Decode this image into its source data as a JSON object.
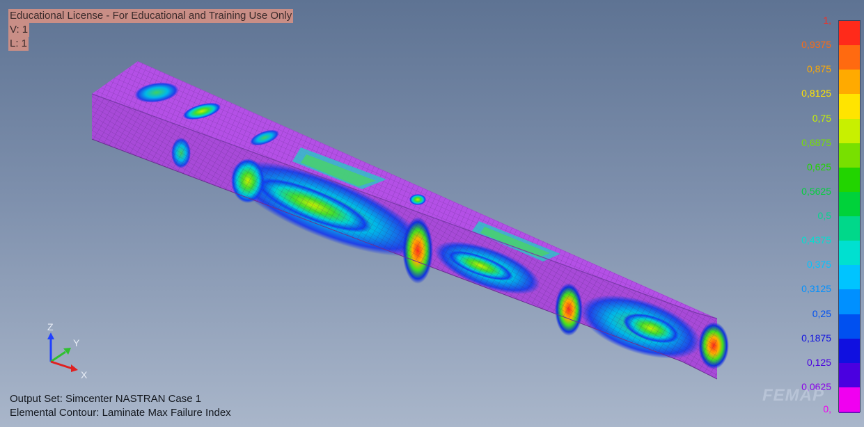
{
  "license_banner": {
    "line1": "Educational License - For Educational and Training Use Only",
    "line2": "V: 1",
    "line3": "L: 1"
  },
  "status": {
    "output_set": "Output Set: Simcenter NASTRAN Case 1",
    "contour": "Elemental Contour: Laminate Max Failure Index"
  },
  "triad": {
    "x": "X",
    "y": "Y",
    "z": "Z"
  },
  "watermark": "FEMAP",
  "legend": {
    "levels": [
      {
        "label": "1,",
        "color": "#ff2a1a"
      },
      {
        "label": "0,9375",
        "color": "#ff6a10"
      },
      {
        "label": "0,875",
        "color": "#ffaa00"
      },
      {
        "label": "0,8125",
        "color": "#ffe400"
      },
      {
        "label": "0,75",
        "color": "#c8f000"
      },
      {
        "label": "0,6875",
        "color": "#78e000"
      },
      {
        "label": "0,625",
        "color": "#22d400"
      },
      {
        "label": "0,5625",
        "color": "#00d23a"
      },
      {
        "label": "0,5",
        "color": "#00d88a"
      },
      {
        "label": "0,4375",
        "color": "#00e0d0"
      },
      {
        "label": "0,375",
        "color": "#00c4ff"
      },
      {
        "label": "0,3125",
        "color": "#0090ff"
      },
      {
        "label": "0,25",
        "color": "#0050f0"
      },
      {
        "label": "0,1875",
        "color": "#1010e0"
      },
      {
        "label": "0,125",
        "color": "#4a00e0"
      },
      {
        "label": "0,0625",
        "color": "#8a00e8"
      },
      {
        "label": "0,",
        "color": "#f000f0"
      }
    ]
  },
  "colors": {
    "mesh_base": "#b04ee0",
    "mesh_lines": "#5a2a80",
    "background_top": "#5e7393",
    "background_bottom": "#a9b6ca"
  }
}
